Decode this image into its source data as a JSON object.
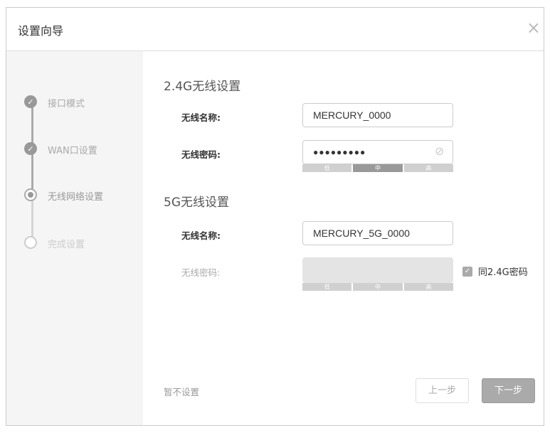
{
  "header": {
    "title": "设置向导",
    "close": "×"
  },
  "steps": [
    {
      "label": "接口模式",
      "state": "done"
    },
    {
      "label": "WAN口设置",
      "state": "done"
    },
    {
      "label": "无线网络设置",
      "state": "current"
    },
    {
      "label": "完成设置",
      "state": "pending"
    }
  ],
  "wifi24": {
    "title": "2.4G无线设置",
    "name_label": "无线名称:",
    "name_value": "MERCURY_0000",
    "pwd_label": "无线密码:",
    "pwd_value": "●●●●●●●●●",
    "strength": [
      "低",
      "中",
      "高"
    ],
    "strength_level": "中"
  },
  "wifi5": {
    "title": "5G无线设置",
    "name_label": "无线名称:",
    "name_value": "MERCURY_5G_0000",
    "pwd_label": "无线密码:",
    "pwd_value": "",
    "strength": [
      "低",
      "中",
      "高"
    ],
    "same_pwd_label": "同2.4G密码",
    "same_pwd_checked": true
  },
  "footer": {
    "skip": "暂不设置",
    "prev": "上一步",
    "next": "下一步"
  }
}
